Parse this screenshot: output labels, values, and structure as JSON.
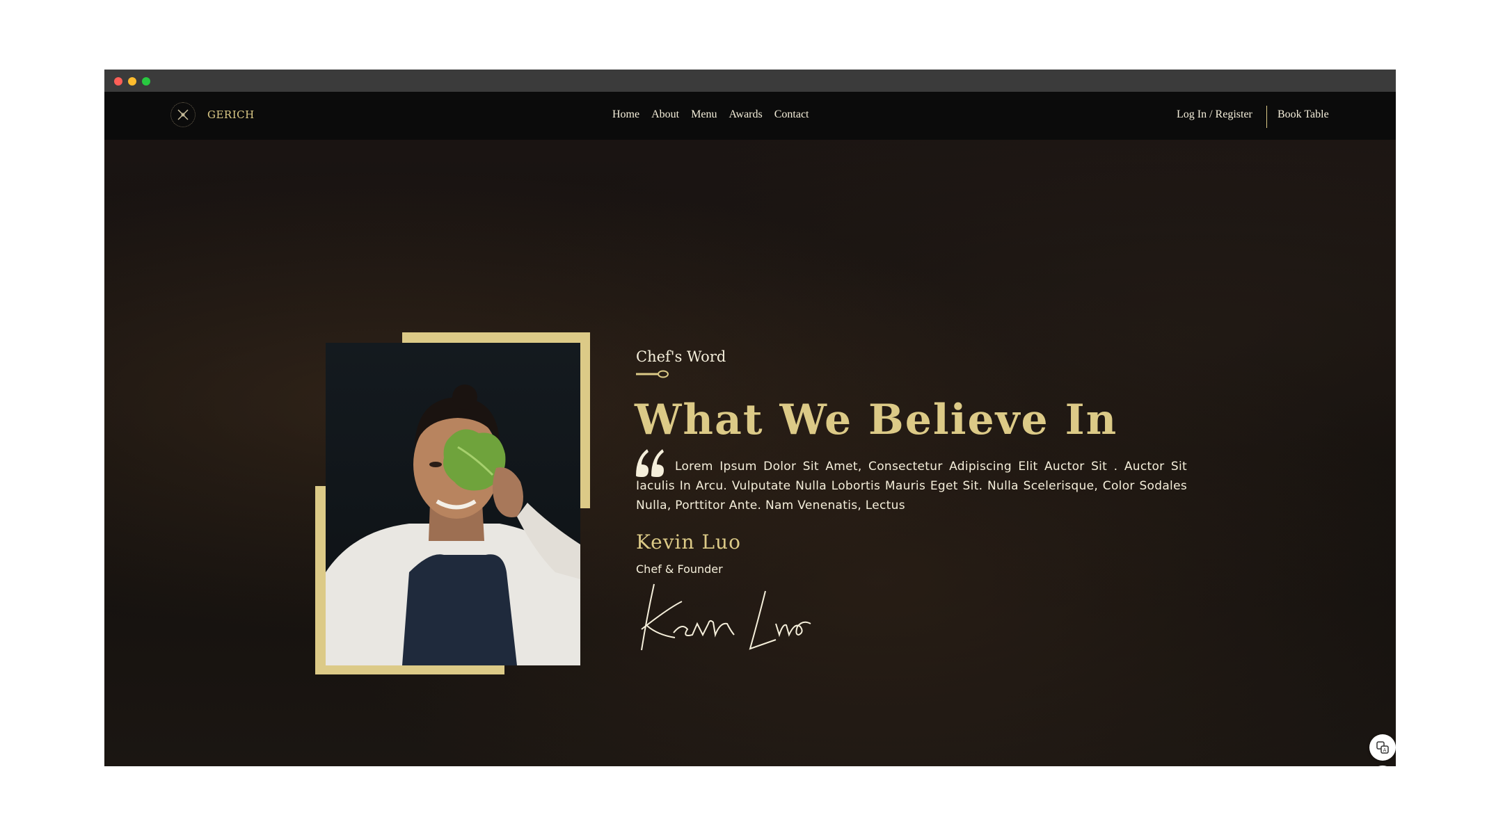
{
  "nav": {
    "logo_text": "GERICH",
    "links": [
      "Home",
      "About",
      "Menu",
      "Awards",
      "Contact"
    ],
    "login": "Log In / Register",
    "book": "Book Table"
  },
  "content": {
    "eyebrow": "Chef's Word",
    "headline": "What We Believe In",
    "quote": "Lorem Ipsum Dolor Sit Amet, Consectetur Adipiscing Elit Auctor Sit . Auctor Sit Iaculis In Arcu. Vulputate Nulla Lobortis Mauris Eget Sit. Nulla Scelerisque, Color Sodales Nulla, Porttitor Ante. Nam Venenatis, Lectus",
    "chef_name": "Kevin Luo",
    "chef_role": "Chef & Founder",
    "signature": "Kevin Luo"
  },
  "colors": {
    "accent": "#dcca87",
    "text": "#f5efdb",
    "navbar": "#0b0b0b"
  },
  "icons": {
    "floating": [
      "translate-icon",
      "reader-icon",
      "brain-icon"
    ]
  }
}
